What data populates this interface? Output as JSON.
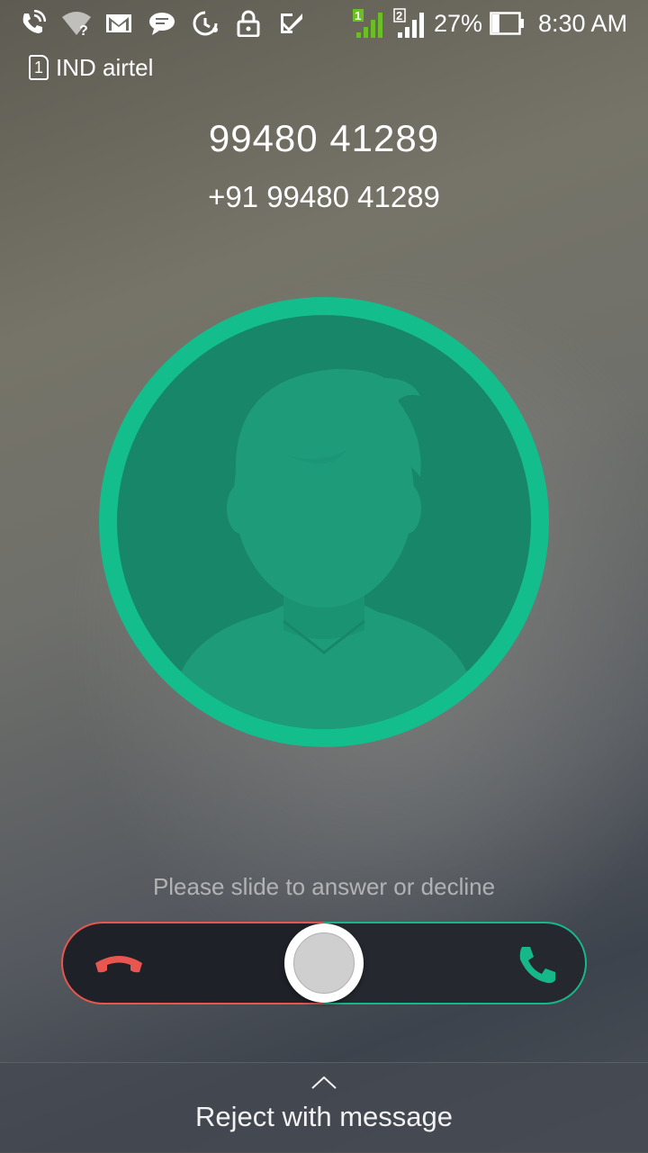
{
  "status_bar": {
    "icons": [
      "wifi-calling-icon",
      "wifi-unknown-icon",
      "gmail-icon",
      "chat-icon",
      "data-saver-icon",
      "lock-icon",
      "ticktick-icon",
      "sim1-signal-icon",
      "sim2-signal-icon",
      "battery-icon"
    ],
    "sim1_badge": "1",
    "sim2_badge": "2",
    "battery_percent": "27%",
    "battery_level": 0.27,
    "time": "8:30 AM"
  },
  "carrier": {
    "sim_slot": "1",
    "name": "IND airtel"
  },
  "caller": {
    "name": "99480 41289",
    "number": "+91 99480 41289"
  },
  "slider": {
    "hint": "Please slide to answer or decline",
    "decline_icon": "decline-call-icon",
    "answer_icon": "answer-call-icon",
    "decline_color": "#e8564f",
    "answer_color": "#16b88a"
  },
  "bottom": {
    "label": "Reject with message"
  },
  "colors": {
    "avatar_ring": "#13bd8c",
    "avatar_fill": "#188669",
    "silhouette": "#1e9c7a"
  }
}
